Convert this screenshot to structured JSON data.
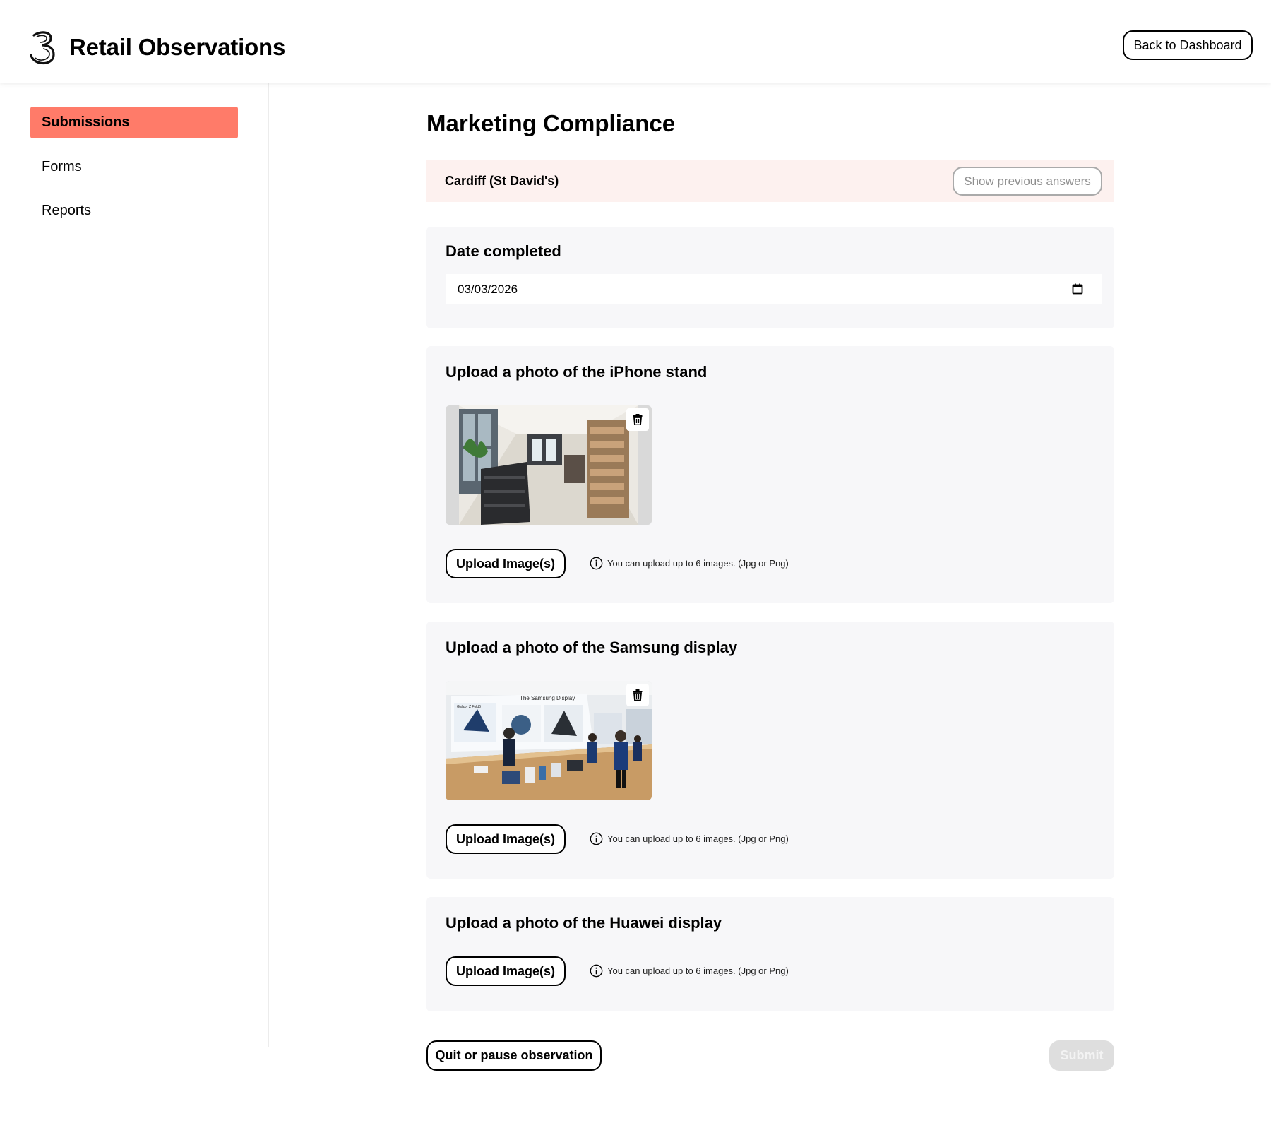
{
  "header": {
    "app_title": "Retail Observations",
    "back_button_label": "Back to Dashboard",
    "logo_icon": "three-logo-icon"
  },
  "sidebar": {
    "items": [
      {
        "label": "Submissions",
        "active": true
      },
      {
        "label": "Forms",
        "active": false
      },
      {
        "label": "Reports",
        "active": false
      }
    ]
  },
  "main": {
    "title": "Marketing Compliance",
    "store": {
      "name": "Cardiff (St David's)",
      "show_previous_label": "Show previous answers"
    },
    "date_section": {
      "label": "Date completed",
      "value": "03/03/2026",
      "icon": "calendar-icon"
    },
    "upload_sections": [
      {
        "title": "Upload a photo of the iPhone stand",
        "has_image": true,
        "button_label": "Upload Image(s)",
        "hint": "You can upload up to 6 images. (Jpg or Png)"
      },
      {
        "title": "Upload a photo of the Samsung display",
        "has_image": true,
        "button_label": "Upload Image(s)",
        "hint": "You can upload up to 6 images. (Jpg or Png)"
      },
      {
        "title": "Upload a photo of the Huawei display",
        "has_image": false,
        "button_label": "Upload Image(s)",
        "hint": "You can upload up to 6 images. (Jpg or Png)"
      }
    ],
    "samsung_photo_sign": "The Samsung Display",
    "samsung_photo_panel": "Galaxy Z Fold6",
    "quit_button_label": "Quit or pause observation",
    "submit_button_label": "Submit"
  },
  "colors": {
    "accent": "#ff7b69",
    "store_bar_bg": "#fdf1ef",
    "card_bg": "#f7f7f9",
    "submit_disabled_bg": "#dedede"
  }
}
